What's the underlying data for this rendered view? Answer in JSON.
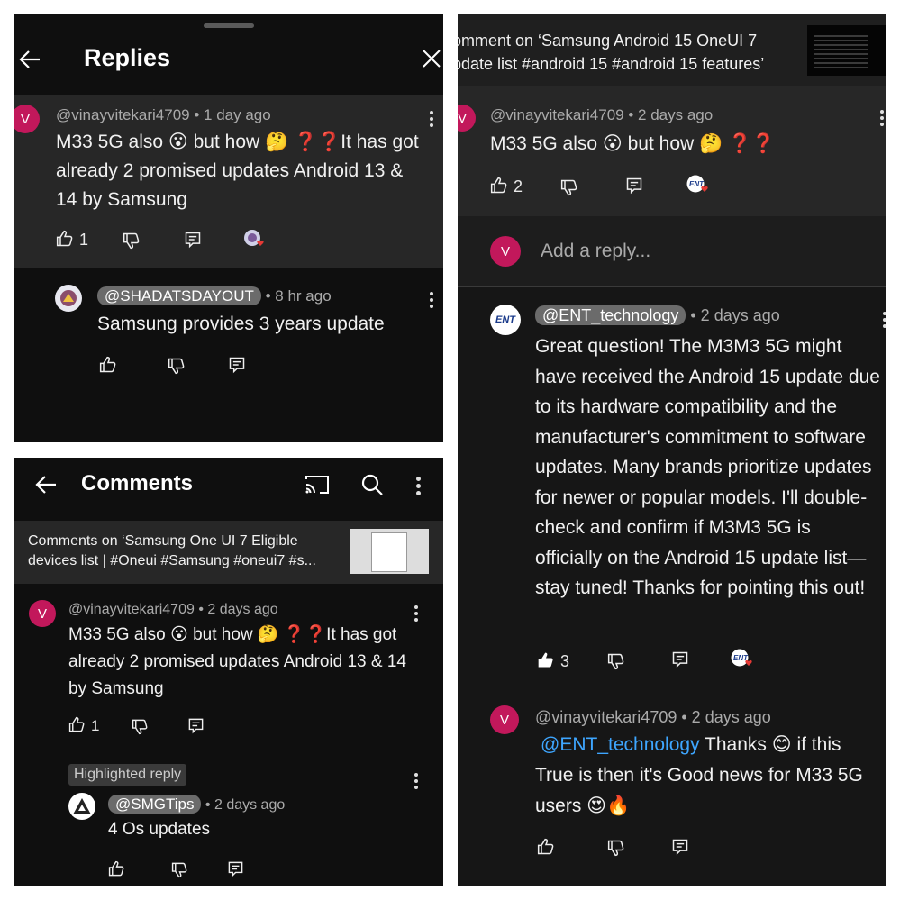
{
  "replies_panel": {
    "title": "Replies",
    "comment": {
      "avatar_letter": "V",
      "author": "@vinayvitekari4709",
      "time": "• 1 day ago",
      "text": "M33 5G also 😮 but how 🤔 ❓❓It has got already 2 promised updates Android 13 & 14 by Samsung",
      "likes": "1"
    },
    "reply": {
      "author": "@SHADATSDAYOUT",
      "time": "• 8 hr ago",
      "text": "Samsung provides 3 years update"
    }
  },
  "comments_panel": {
    "title": "Comments",
    "banner_text": "Comments on ‘Samsung One UI 7 Eligible devices list | #Oneui #Samsung #oneui7 #s...",
    "comment": {
      "avatar_letter": "V",
      "author": "@vinayvitekari4709",
      "time": "• 2 days ago",
      "text": "M33 5G also 😮 but how 🤔 ❓❓It has got already 2 promised updates Android 13 & 14 by Samsung",
      "likes": "1"
    },
    "highlighted_label": "Highlighted reply",
    "reply": {
      "author": "@SMGTips",
      "time": "• 2 days ago",
      "text": "4 Os updates"
    }
  },
  "thread_panel": {
    "banner_text_1": "omment on ‘Samsung Android 15 OneUI 7",
    "banner_text_2": "pdate list #android 15 #android 15  features’",
    "comment": {
      "avatar_letter": "V",
      "author": "@vinayvitekari4709",
      "time": "• 2 days ago",
      "text": "M33 5G also 😮 but how 🤔 ❓❓",
      "likes": "2"
    },
    "reply_input": {
      "avatar_letter": "V",
      "placeholder": "Add a reply..."
    },
    "reply1": {
      "avatar_text": "ENT",
      "author": "@ENT_technology",
      "time": "• 2 days ago",
      "text": "Great question! The M3M3 5G might have received the Android 15 update due to its hardware compatibility and the manufacturer's commitment to software updates. Many brands prioritize updates for newer or popular models. I'll double-check and confirm if M3M3 5G is officially on the Android 15 update list—stay tuned! Thanks for pointing this out!",
      "likes": "3"
    },
    "reply2": {
      "avatar_letter": "V",
      "author": "@vinayvitekari4709",
      "time": "• 2 days ago",
      "mention": "@ENT_technology",
      "text": "Thanks 😊 if this True is then it's Good news for M33 5G users 😍🔥"
    }
  },
  "colors": {
    "background": "#0f0f0f",
    "avatar_pink": "#c2185b",
    "link_blue": "#3ea6ff",
    "heart_red": "#e53935"
  },
  "icons": [
    "back-arrow-icon",
    "close-icon",
    "more-vert-icon",
    "thumbs-up-icon",
    "thumbs-down-icon",
    "reply-icon",
    "cast-icon",
    "search-icon",
    "creator-heart-icon"
  ]
}
